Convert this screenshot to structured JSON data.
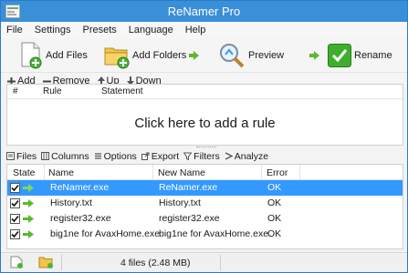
{
  "window": {
    "title": "ReNamer Pro"
  },
  "menu": [
    "File",
    "Settings",
    "Presets",
    "Language",
    "Help"
  ],
  "toolbar": {
    "add_files": "Add Files",
    "add_folders": "Add Folders",
    "preview": "Preview",
    "rename": "Rename"
  },
  "rules_toolbar": {
    "add": "Add",
    "remove": "Remove",
    "up": "Up",
    "down": "Down"
  },
  "rules": {
    "columns": [
      "#",
      "Rule",
      "Statement"
    ],
    "empty_prompt": "Click here to add a rule"
  },
  "files_toolbar": {
    "files": "Files",
    "columns": "Columns",
    "options": "Options",
    "export": "Export",
    "filters": "Filters",
    "analyze": "Analyze"
  },
  "files": {
    "columns": [
      "State",
      "Name",
      "New Name",
      "Error"
    ],
    "rows": [
      {
        "name": "ReNamer.exe",
        "new_name": "ReNamer.exe",
        "error": "OK"
      },
      {
        "name": "History.txt",
        "new_name": "History.txt",
        "error": "OK"
      },
      {
        "name": "register32.exe",
        "new_name": "register32.exe",
        "error": "OK"
      },
      {
        "name": "big1ne for AvaxHome.exe",
        "new_name": "big1ne for AvaxHome.exe",
        "error": "OK"
      }
    ]
  },
  "status": {
    "text": "4 files (2.48 MB)"
  },
  "colors": {
    "titlebar": "#3a8fd9",
    "selection": "#3399ff",
    "arrow": "#5cb82e"
  }
}
